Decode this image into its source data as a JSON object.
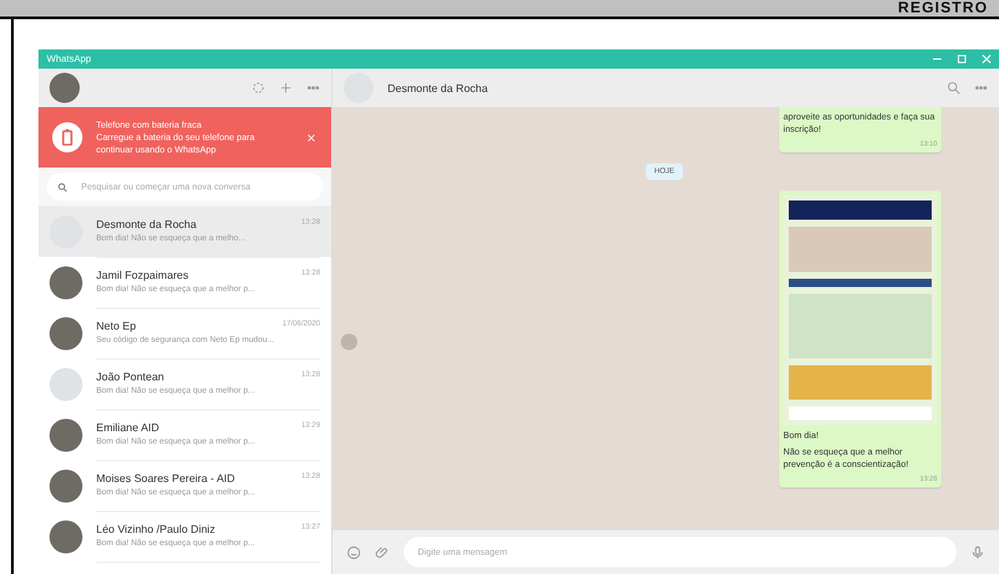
{
  "frame_heading": "REGISTRO",
  "app": {
    "title": "WhatsApp"
  },
  "alert": {
    "title": "Telefone com bateria fraca",
    "body": "Carregue a bateria do seu telefone para continuar usando o WhatsApp"
  },
  "search": {
    "placeholder": "Pesquisar ou começar uma nova conversa"
  },
  "chats": [
    {
      "name": "Desmonte da Rocha",
      "time": "13:28",
      "preview": "Bom dia! Não se esqueça que a melho...",
      "photo": false,
      "selected": true
    },
    {
      "name": "Jamil Fozpaimares",
      "time": "13:28",
      "preview": "Bom dia! Não se esqueça que a melhor p...",
      "photo": true,
      "selected": false
    },
    {
      "name": "Neto Ep",
      "time": "17/06/2020",
      "preview": "Seu código de segurança com Neto Ep mudou...",
      "photo": true,
      "selected": false
    },
    {
      "name": "João Pontean",
      "time": "13:28",
      "preview": "Bom dia! Não se esqueça que a melhor p...",
      "photo": false,
      "selected": false
    },
    {
      "name": "Emiliane AID",
      "time": "13:29",
      "preview": "Bom dia! Não se esqueça que a melhor p...",
      "photo": true,
      "selected": false
    },
    {
      "name": "Moises Soares Pereira - AID",
      "time": "13:28",
      "preview": "Bom dia! Não se esqueça que a melhor p...",
      "photo": true,
      "selected": false
    },
    {
      "name": "Léo Vizinho /Paulo Diniz",
      "time": "13:27",
      "preview": "Bom dia! Não se esqueça que a melhor p...",
      "photo": true,
      "selected": false
    }
  ],
  "conversation": {
    "name": "Desmonte da Rocha",
    "messages": [
      {
        "kind": "text",
        "text": "aproveite as oportunidades e faça sua inscrição!",
        "time": "13:10"
      },
      {
        "kind": "date",
        "text": "HOJE"
      },
      {
        "kind": "image",
        "lines": [
          "Bom dia!",
          "Não se esqueça que a melhor prevenção é a conscientização!"
        ],
        "time": "13:28"
      }
    ]
  },
  "composer": {
    "placeholder": "Digite uma mensagem"
  }
}
